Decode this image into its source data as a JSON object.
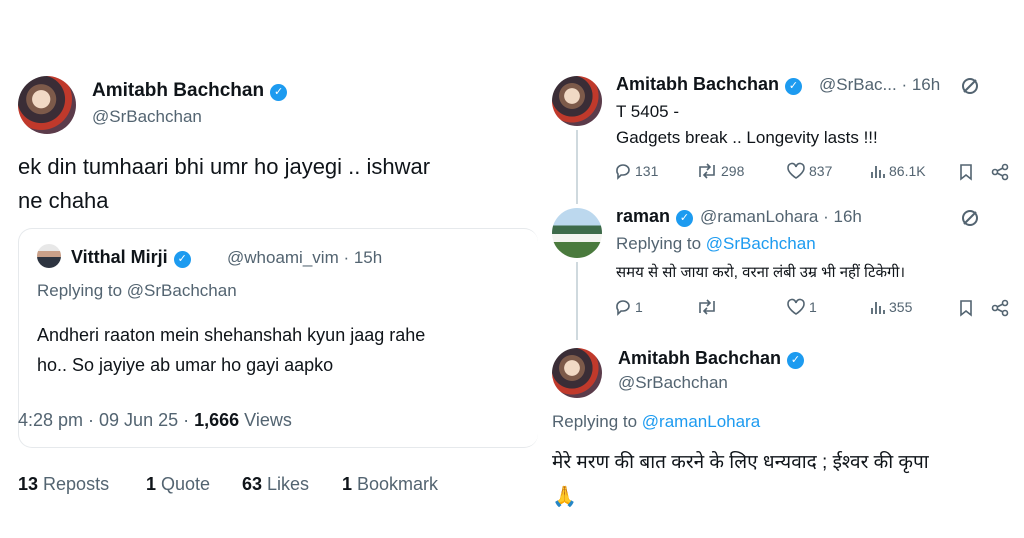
{
  "left": {
    "author": {
      "name": "Amitabh Bachchan",
      "handle": "@SrBachchan"
    },
    "tweet_text_line1": "ek din tumhaari bhi umr ho jayegi .. ishwar",
    "tweet_text_line2": "ne chaha",
    "quoted": {
      "name": "Vitthal Mirji",
      "handle_time": "@whoami_vim · 15h",
      "replying_prefix": "Replying to",
      "replying_handle": "@SrBachchan",
      "text_line1": "Andheri raaton mein shehanshah kyun jaag rahe",
      "text_line2": "ho.. So jayiye ab umar ho gayi aapko"
    },
    "meta": {
      "time_date": "4:28 pm · 09 Jun 25 · ",
      "views_count": "1,666",
      "views_label": " Views"
    },
    "stats": [
      {
        "count": "13",
        "label": " Reposts"
      },
      {
        "count": "1",
        "label": " Quote"
      },
      {
        "count": "63",
        "label": " Likes"
      },
      {
        "count": "1",
        "label": " Bookmark"
      }
    ]
  },
  "right": {
    "tweet1": {
      "name": "Amitabh Bachchan",
      "handle_time": "@SrBac... · 16h",
      "text_line1": "T 5405 -",
      "text_line2": "Gadgets break .. Longevity lasts  !!!",
      "actions": {
        "replies": "131",
        "reposts": "298",
        "likes": "837",
        "views": "86.1K"
      }
    },
    "tweet2": {
      "name": "raman",
      "handle_time": "@ramanLohara · 16h",
      "replying_prefix": "Replying to",
      "replying_handle": "@SrBachchan",
      "text": "समय से सो जाया करो, वरना लंबी उम्र भी नहीं टिकेगी।",
      "actions": {
        "replies": "1",
        "reposts": "",
        "likes": "1",
        "views": "355"
      }
    },
    "tweet3": {
      "name": "Amitabh Bachchan",
      "handle": "@SrBachchan",
      "replying_prefix": "Replying to",
      "replying_handle": "@ramanLohara",
      "text": "मेरे मरण की बात करने के लिए धन्यवाद  ; ईश्वर  की कृपा",
      "emoji": "🙏"
    }
  },
  "colors": {
    "accent": "#1d9bf0",
    "muted": "#536471",
    "text": "#0f1419"
  }
}
